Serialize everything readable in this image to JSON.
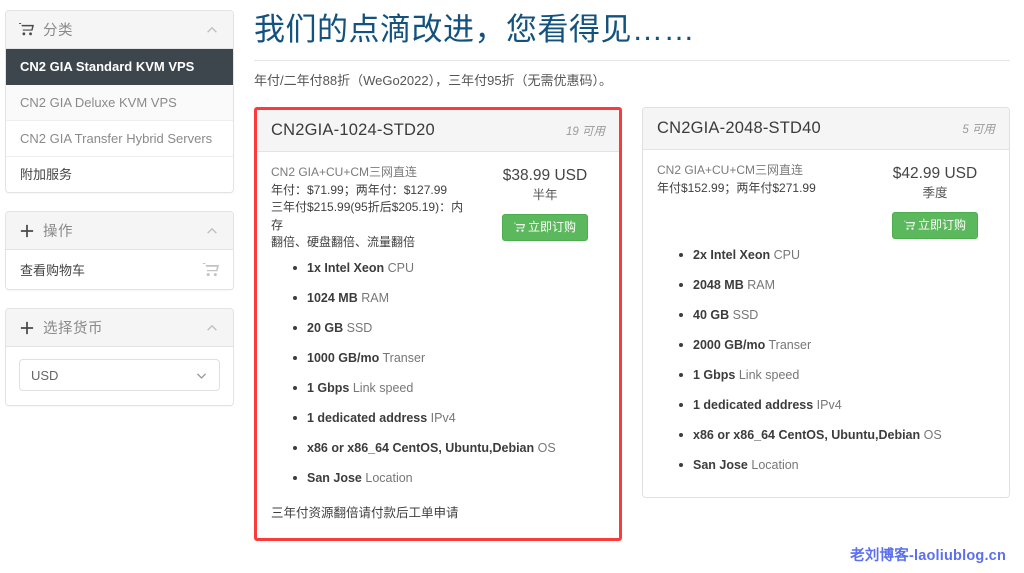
{
  "sidebar": {
    "panels": [
      {
        "icon": "cart-icon",
        "title": "分类",
        "collapse_icon": "chevron-up-icon",
        "items": [
          {
            "label": "CN2 GIA Standard KVM VPS",
            "active": true
          },
          {
            "label": "CN2 GIA Deluxe KVM VPS",
            "active": false
          },
          {
            "label": "CN2 GIA Transfer Hybrid Servers",
            "active": false
          },
          {
            "label": "附加服务",
            "active": false
          }
        ]
      },
      {
        "icon": "plus-icon",
        "title": "操作",
        "collapse_icon": "chevron-up-icon",
        "cart_label": "查看购物车",
        "cart_icon": "cart-icon"
      },
      {
        "icon": "plus-icon",
        "title": "选择货币",
        "collapse_icon": "chevron-up-icon",
        "currency_value": "USD",
        "currency_chevron": "chevron-down-icon"
      }
    ]
  },
  "main": {
    "title": "我们的点滴改进，您看得见……",
    "subtitle": "年付/二年付88折（WeGo2022），三年付95折（无需优惠码）。",
    "cards": [
      {
        "name": "CN2GIA-1024-STD20",
        "stock": "19 可用",
        "highlighted": true,
        "desc_lines": [
          "CN2 GIA+CU+CM三网直连",
          "年付：$71.99；两年付：$127.99",
          "三年付$215.99(95折后$205.19)：内存",
          "翻倍、硬盘翻倍、流量翻倍"
        ],
        "price": "$38.99 USD",
        "cycle": "半年",
        "order_label": "立即订购",
        "order_icon": "cart-icon",
        "features": [
          {
            "strong": "1x Intel Xeon",
            "rest": " CPU"
          },
          {
            "strong": "1024 MB",
            "rest": " RAM"
          },
          {
            "strong": "20 GB",
            "rest": " SSD"
          },
          {
            "strong": "1000 GB/mo",
            "rest": " Transer"
          },
          {
            "strong": "1 Gbps",
            "rest": " Link speed"
          },
          {
            "strong": "1 dedicated address",
            "rest": " IPv4"
          },
          {
            "strong": "x86 or x86_64 CentOS, Ubuntu,Debian",
            "rest": " OS"
          },
          {
            "strong": "San Jose",
            "rest": " Location"
          }
        ],
        "note": "三年付资源翻倍请付款后工单申请"
      },
      {
        "name": "CN2GIA-2048-STD40",
        "stock": "5 可用",
        "highlighted": false,
        "desc_lines": [
          "CN2 GIA+CU+CM三网直连",
          "年付$152.99；两年付$271.99"
        ],
        "price": "$42.99 USD",
        "cycle": "季度",
        "order_label": "立即订购",
        "order_icon": "cart-icon",
        "features": [
          {
            "strong": "2x Intel Xeon",
            "rest": " CPU"
          },
          {
            "strong": "2048 MB",
            "rest": " RAM"
          },
          {
            "strong": "40 GB",
            "rest": " SSD"
          },
          {
            "strong": "2000 GB/mo",
            "rest": " Transer"
          },
          {
            "strong": "1 Gbps",
            "rest": " Link speed"
          },
          {
            "strong": "1 dedicated address",
            "rest": " IPv4"
          },
          {
            "strong": "x86 or x86_64 CentOS, Ubuntu,Debian",
            "rest": " OS"
          },
          {
            "strong": "San Jose",
            "rest": " Location"
          }
        ],
        "note": ""
      }
    ]
  },
  "watermark": "老刘博客-laoliublog.cn",
  "colors": {
    "title": "#13527f",
    "highlight_border": "#fb3b3b",
    "order_button": "#5cb85c",
    "active_item": "#3d464d",
    "watermark": "#5b6ff0"
  }
}
